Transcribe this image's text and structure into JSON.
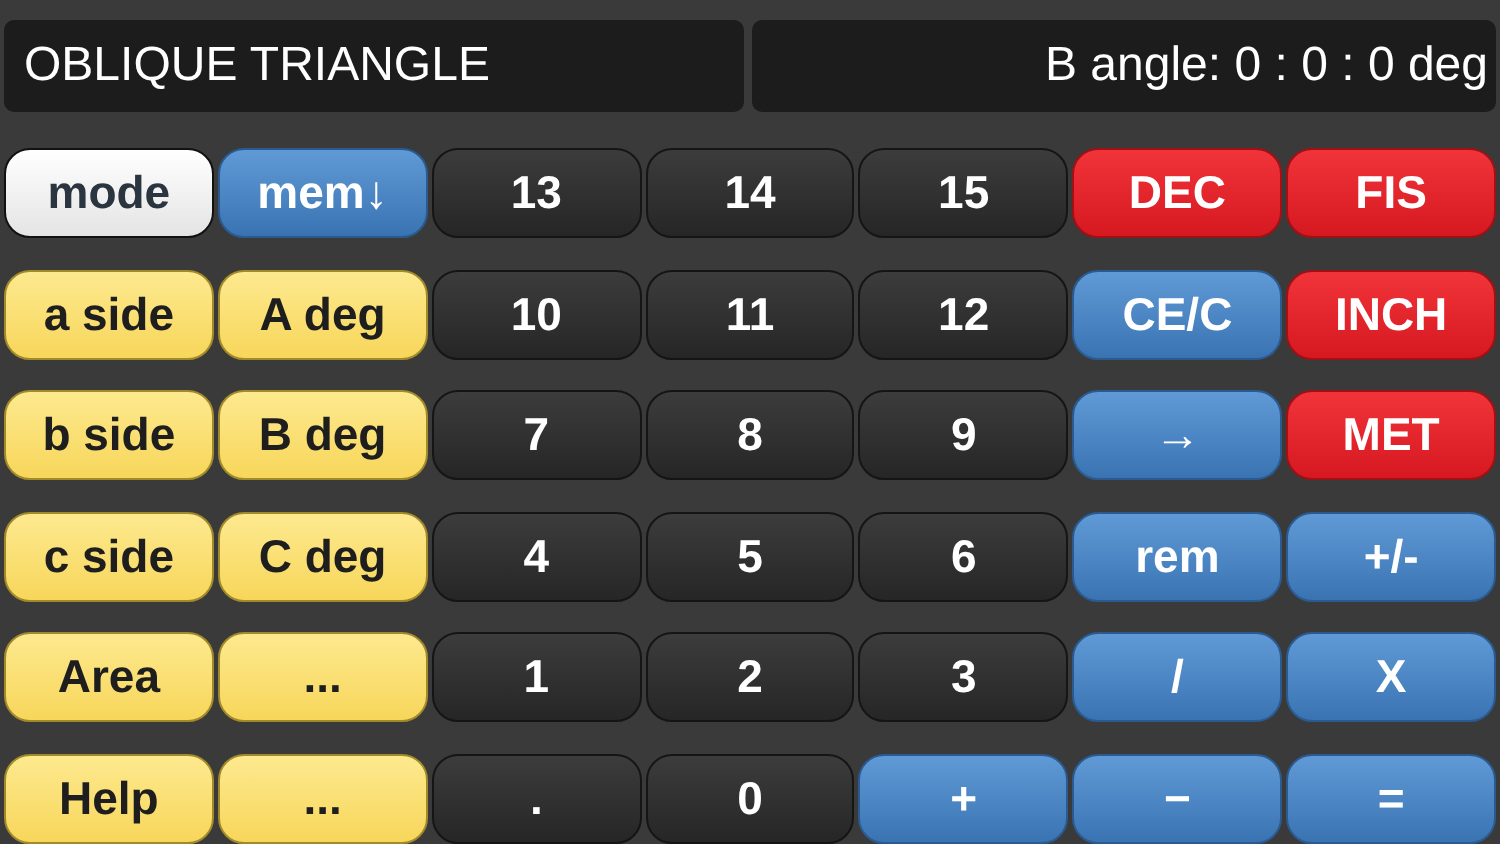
{
  "display": {
    "title": "OBLIQUE TRIANGLE",
    "readout": "B angle: 0 : 0 : 0 deg"
  },
  "keys": [
    {
      "label": "mode",
      "kind": "white"
    },
    {
      "label": "mem↓",
      "kind": "blue"
    },
    {
      "label": "13",
      "kind": "dark"
    },
    {
      "label": "14",
      "kind": "dark"
    },
    {
      "label": "15",
      "kind": "dark"
    },
    {
      "label": "DEC",
      "kind": "red"
    },
    {
      "label": "FIS",
      "kind": "red"
    },
    {
      "label": "a side",
      "kind": "yellow"
    },
    {
      "label": "A deg",
      "kind": "yellow"
    },
    {
      "label": "10",
      "kind": "dark"
    },
    {
      "label": "11",
      "kind": "dark"
    },
    {
      "label": "12",
      "kind": "dark"
    },
    {
      "label": "CE/C",
      "kind": "blue"
    },
    {
      "label": "INCH",
      "kind": "red"
    },
    {
      "label": "b side",
      "kind": "yellow"
    },
    {
      "label": "B deg",
      "kind": "yellow"
    },
    {
      "label": "7",
      "kind": "dark"
    },
    {
      "label": "8",
      "kind": "dark"
    },
    {
      "label": "9",
      "kind": "dark"
    },
    {
      "label": "→",
      "kind": "blue"
    },
    {
      "label": "MET",
      "kind": "red"
    },
    {
      "label": "c side",
      "kind": "yellow"
    },
    {
      "label": "C deg",
      "kind": "yellow"
    },
    {
      "label": "4",
      "kind": "dark"
    },
    {
      "label": "5",
      "kind": "dark"
    },
    {
      "label": "6",
      "kind": "dark"
    },
    {
      "label": "rem",
      "kind": "blue"
    },
    {
      "label": "+/-",
      "kind": "blue"
    },
    {
      "label": "Area",
      "kind": "yellow"
    },
    {
      "label": "...",
      "kind": "yellow"
    },
    {
      "label": "1",
      "kind": "dark"
    },
    {
      "label": "2",
      "kind": "dark"
    },
    {
      "label": "3",
      "kind": "dark"
    },
    {
      "label": "/",
      "kind": "blue"
    },
    {
      "label": "X",
      "kind": "blue"
    },
    {
      "label": "Help",
      "kind": "yellow"
    },
    {
      "label": "...",
      "kind": "yellow"
    },
    {
      "label": ".",
      "kind": "dark"
    },
    {
      "label": "0",
      "kind": "dark"
    },
    {
      "label": "+",
      "kind": "blue"
    },
    {
      "label": "−",
      "kind": "blue"
    },
    {
      "label": "=",
      "kind": "blue"
    }
  ]
}
